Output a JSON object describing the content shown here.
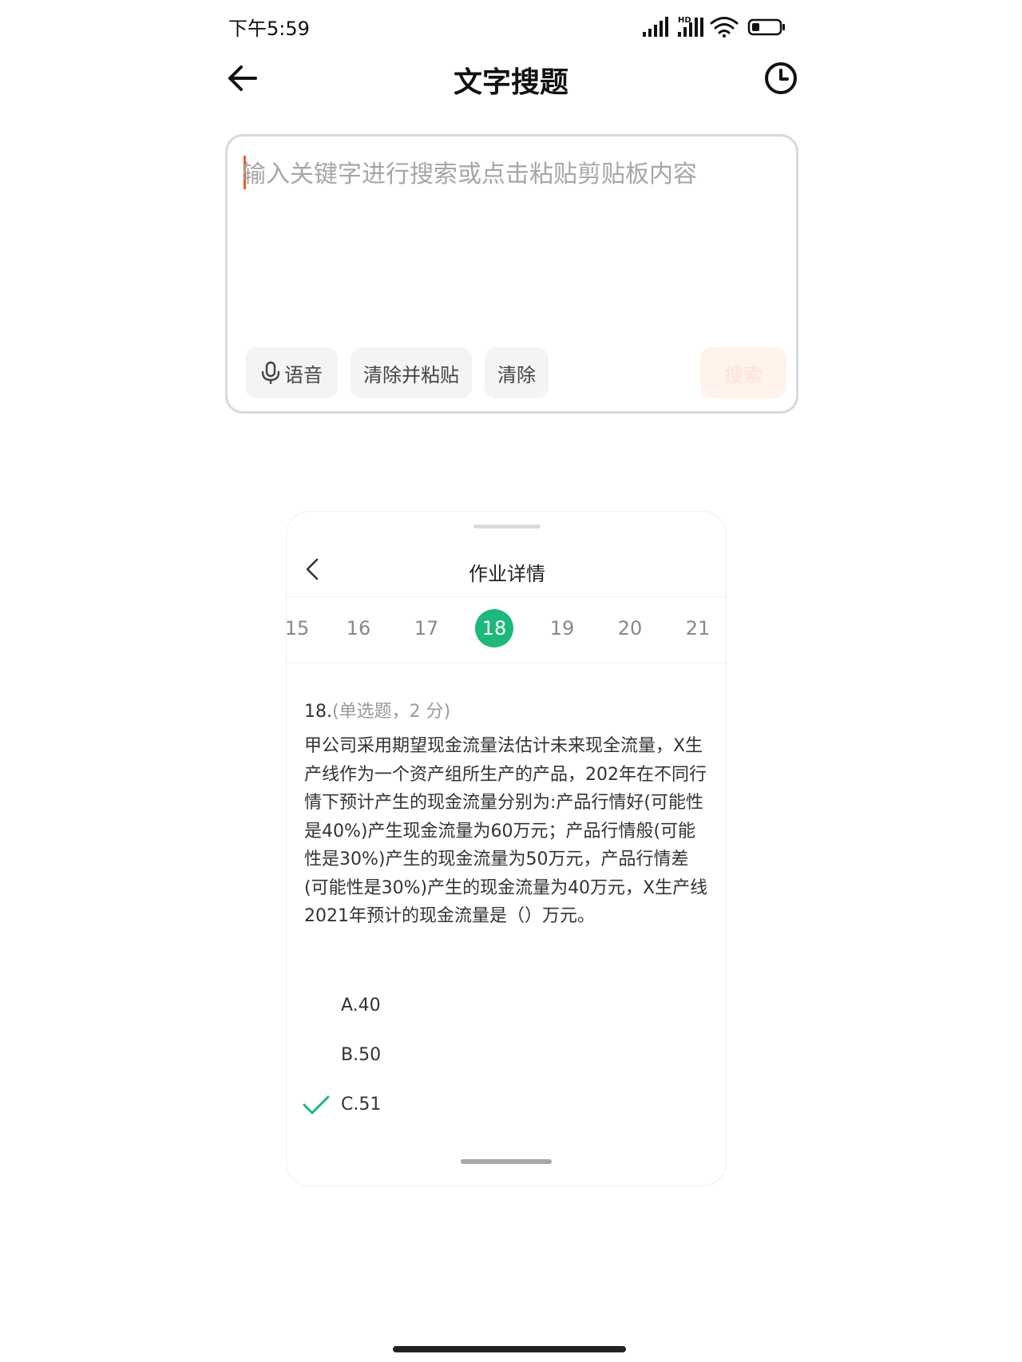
{
  "status_bar": {
    "time": "下午5:59",
    "icons": [
      "signal-icon",
      "hd-signal-icon",
      "wifi-icon",
      "battery-icon"
    ]
  },
  "header": {
    "title": "文字搜题",
    "back_icon": "arrow-left-icon",
    "history_icon": "clock-icon"
  },
  "search": {
    "value": "",
    "placeholder": "输入关键字进行搜索或点击粘贴剪贴板内容",
    "voice_label": "语音",
    "clear_paste_label": "清除并粘贴",
    "clear_label": "清除",
    "search_label": "搜索"
  },
  "homework": {
    "title": "作业详情",
    "question_numbers": [
      "15",
      "16",
      "17",
      "18",
      "19",
      "20",
      "21"
    ],
    "active_question": "18",
    "question_number": "18.",
    "question_meta": "(单选题，2 分)",
    "question_text": "甲公司采用期望现金流量法估计未来现全流量，X生产线作为一个资产组所生产的产品，202年在不同行情下预计产生的现金流量分别为:产品行情好(可能性是40%)产生现金流量为60万元；产品行情般(可能性是30%)产生的现金流量为50万元，产品行情差(可能性是30%)产生的现金流量为40万元，X生产线2021年预计的现金流量是（）万元。",
    "options": [
      {
        "label": "A.40",
        "checked": false
      },
      {
        "label": "B.50",
        "checked": false
      },
      {
        "label": "C.51",
        "checked": true
      }
    ]
  },
  "colors": {
    "accent_green": "#1db87b",
    "search_button_bg": "#fff3ec",
    "cursor_orange": "#e0622a"
  }
}
